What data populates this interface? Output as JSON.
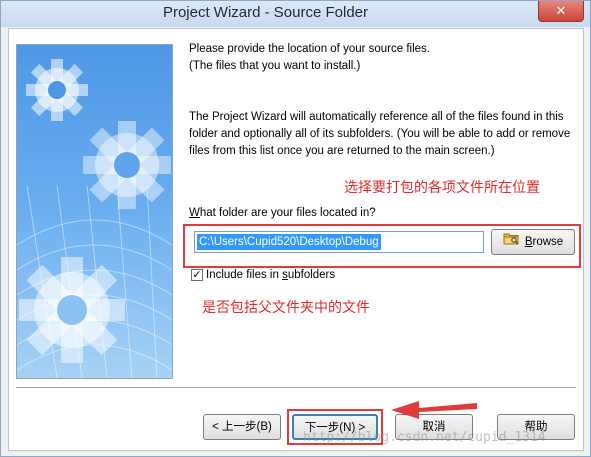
{
  "window": {
    "title": "Project Wizard - Source Folder",
    "close_glyph": "✕"
  },
  "intro": {
    "line1": "Please provide the location of your source files.",
    "line2": "(The files that you want to install.)"
  },
  "description": "The Project Wizard will automatically reference all of the files found in this folder and optionally all of its subfolders. (You will be able to add or remove files from this list once you are returned to the main screen.)",
  "annotations": {
    "location_note": "选择要打包的各项文件所在位置",
    "subfolder_note": "是否包括父文件夹中的文件"
  },
  "folder": {
    "label_prefix": "W",
    "label_rest": "hat folder are your files located in?",
    "path_value": "C:\\Users\\Cupid520\\Desktop\\Debug",
    "browse_label_prefix": "B",
    "browse_label_rest": "rowse",
    "browse_icon": "folder-icon"
  },
  "subfolders": {
    "checked": true,
    "label_prefix": "Include files in ",
    "label_underline": "s",
    "label_rest": "ubfolders"
  },
  "buttons": {
    "back": "< 上一步(B)",
    "next": "下一步(N) >",
    "cancel": "取消",
    "help": "帮助"
  },
  "watermark": "http://blog.csdn.net/cupid_1314",
  "colors": {
    "annotation_red": "#e23b3b",
    "selection_blue": "#3399ff"
  }
}
